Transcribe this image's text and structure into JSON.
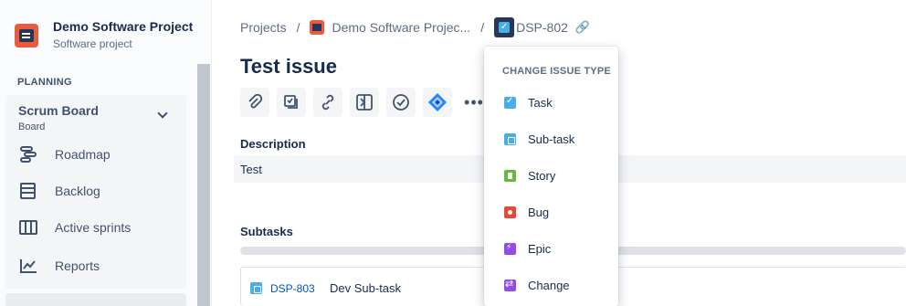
{
  "sidebar": {
    "project_name": "Demo Software Project",
    "project_type": "Software project",
    "section_label": "PLANNING",
    "board": {
      "title": "Scrum Board",
      "subtitle": "Board"
    },
    "items": [
      {
        "label": "Roadmap",
        "icon": "roadmap-icon"
      },
      {
        "label": "Backlog",
        "icon": "backlog-icon"
      },
      {
        "label": "Active sprints",
        "icon": "board-columns-icon"
      },
      {
        "label": "Reports",
        "icon": "chart-icon"
      }
    ]
  },
  "breadcrumb": {
    "projects": "Projects",
    "separator": "/",
    "project": "Demo Software Projec...",
    "issue_key": "DSP-802"
  },
  "issue": {
    "title": "Test issue",
    "description_label": "Description",
    "description_text": "Test",
    "subtasks_label": "Subtasks",
    "subtasks": [
      {
        "key": "DSP-803",
        "summary": "Dev Sub-task"
      }
    ]
  },
  "toolbar": {
    "buttons": [
      "attach-icon",
      "add-child-icon",
      "link-icon",
      "confluence-icon",
      "checklist-icon",
      "app-icon",
      "more-icon"
    ],
    "more_label": "•••"
  },
  "dropdown": {
    "header": "CHANGE ISSUE TYPE",
    "items": [
      {
        "label": "Task",
        "color": "#4BADE8"
      },
      {
        "label": "Sub-task",
        "color": "#4BADE8"
      },
      {
        "label": "Story",
        "color": "#63BA3C"
      },
      {
        "label": "Bug",
        "color": "#E5493A"
      },
      {
        "label": "Epic",
        "color": "#904EE2"
      },
      {
        "label": "Change",
        "color": "#904EE2"
      }
    ]
  },
  "colors": {
    "brand": "#EA5A3C",
    "link": "#0052CC",
    "text": "#172B4D"
  }
}
